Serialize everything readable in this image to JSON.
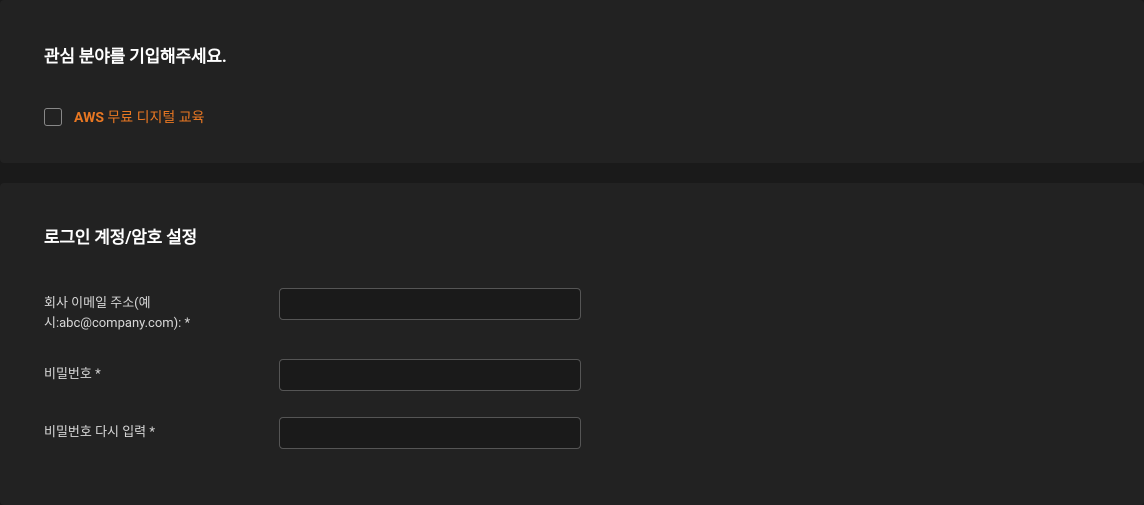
{
  "interests": {
    "title": "관심 분야를 기입해주세요.",
    "checkbox": {
      "bold": "AWS",
      "rest": " 무료 디지털 교육"
    }
  },
  "login": {
    "title": "로그인 계정/암호 설정",
    "fields": {
      "email": {
        "label": "회사 이메일 주소(예시:abc@company.com): *"
      },
      "password": {
        "label": "비밀번호 *"
      },
      "password_confirm": {
        "label": "비밀번호 다시 입력 *"
      }
    }
  }
}
